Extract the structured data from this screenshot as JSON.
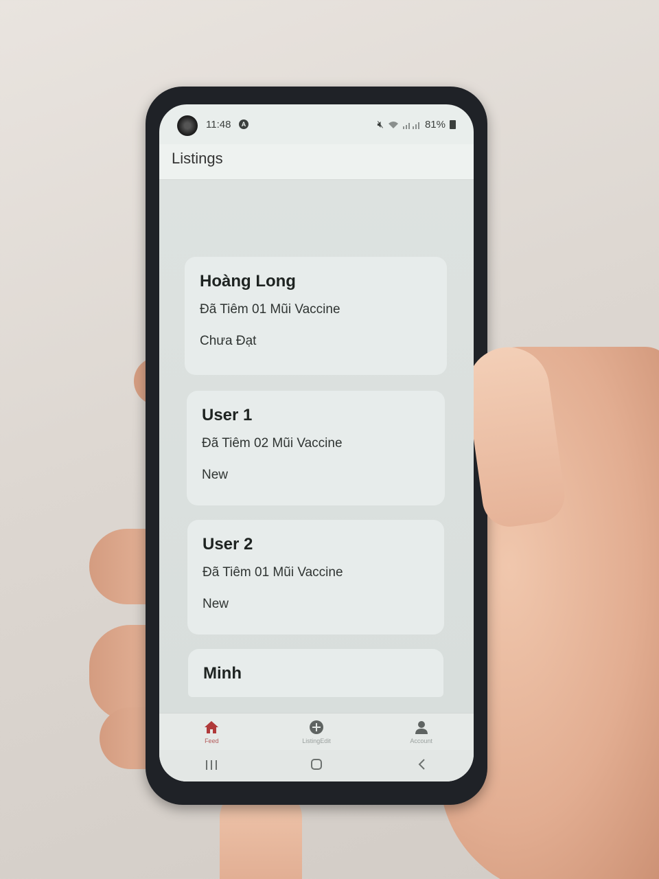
{
  "status_bar": {
    "time": "11:48",
    "battery": "81%"
  },
  "header": {
    "title": "Listings"
  },
  "listings": [
    {
      "name": "Hoàng Long",
      "dose": "Đã Tiêm 01 Mũi Vaccine",
      "status": "Chưa Đạt"
    },
    {
      "name": "User 1",
      "dose": "Đã Tiêm 02 Mũi Vaccine",
      "status": "New"
    },
    {
      "name": "User 2",
      "dose": "Đã Tiêm 01 Mũi Vaccine",
      "status": "New"
    },
    {
      "name": "Minh"
    }
  ],
  "bottom_nav": {
    "items": [
      {
        "label": "Feed",
        "icon": "home-icon",
        "active": true
      },
      {
        "label": "ListingEdit",
        "icon": "add-circle-icon"
      },
      {
        "label": "Account",
        "icon": "person-icon"
      }
    ]
  },
  "colors": {
    "active_tab": "#b03a3a",
    "inactive_icon": "#5f6462"
  }
}
